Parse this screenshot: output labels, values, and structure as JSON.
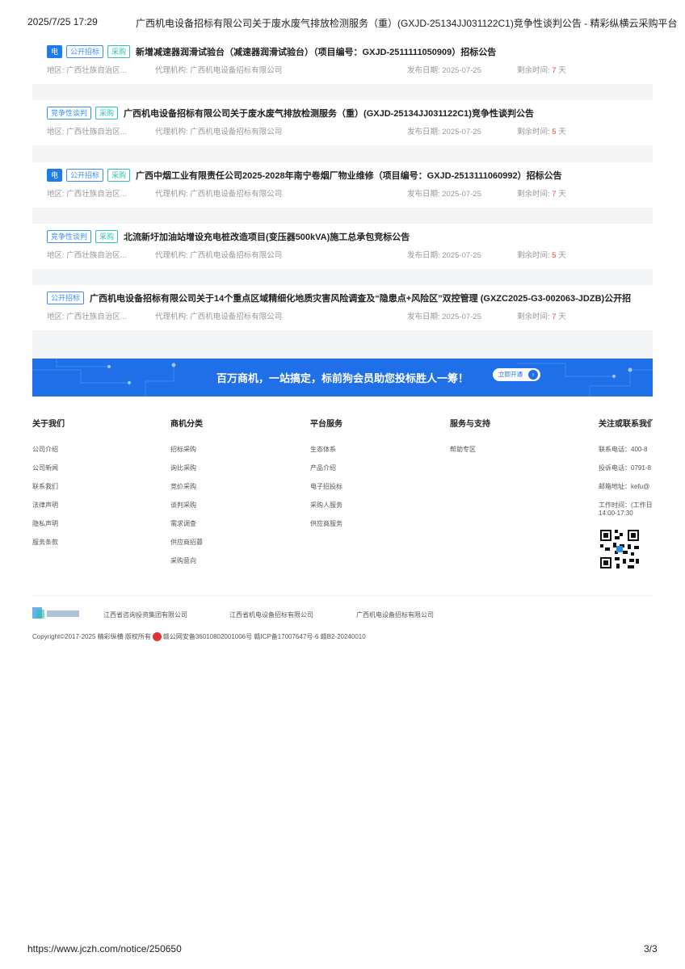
{
  "print_header": {
    "datetime": "2025/7/25 17:29",
    "title": "广西机电设备招标有限公司关于废水废气排放检测服务（重）(GXJD-25134JJ031122C1)竞争性谈判公告 - 精彩纵横云采购平台"
  },
  "notices": [
    {
      "tags": [
        {
          "label": "电",
          "style": "solid"
        },
        {
          "label": "公开招标",
          "style": "blue"
        },
        {
          "label": "采购",
          "style": "green"
        }
      ],
      "title": "新增减速器润滑试验台（减速器润滑试验台）（项目编号：GXJD-2511111050909）招标公告",
      "region": "地区: 广西壮族自治区...",
      "agency": "代理机构: 广西机电设备招标有限公司",
      "publish": "发布日期: 2025-07-25",
      "remaining_label": "剩余时间: ",
      "remaining_days": "7",
      "remaining_unit": " 天"
    },
    {
      "tags": [
        {
          "label": "竞争性谈判",
          "style": "blue"
        },
        {
          "label": "采购",
          "style": "green"
        }
      ],
      "title": "广西机电设备招标有限公司关于废水废气排放检测服务（重）(GXJD-25134JJ031122C1)竞争性谈判公告",
      "region": "地区: 广西壮族自治区...",
      "agency": "代理机构: 广西机电设备招标有限公司",
      "publish": "发布日期: 2025-07-25",
      "remaining_label": "剩余时间: ",
      "remaining_days": "5",
      "remaining_unit": " 天"
    },
    {
      "tags": [
        {
          "label": "电",
          "style": "solid"
        },
        {
          "label": "公开招标",
          "style": "blue"
        },
        {
          "label": "采购",
          "style": "green"
        }
      ],
      "title": "广西中烟工业有限责任公司2025-2028年南宁卷烟厂物业维修（项目编号：GXJD-2513111060992）招标公告",
      "region": "地区: 广西壮族自治区...",
      "agency": "代理机构: 广西机电设备招标有限公司",
      "publish": "发布日期: 2025-07-25",
      "remaining_label": "剩余时间: ",
      "remaining_days": "7",
      "remaining_unit": " 天"
    },
    {
      "tags": [
        {
          "label": "竞争性谈判",
          "style": "blue"
        },
        {
          "label": "采购",
          "style": "green"
        }
      ],
      "title": "北流新圩加油站增设充电桩改造项目(变压器500kVA)施工总承包竞标公告",
      "region": "地区: 广西壮族自治区...",
      "agency": "代理机构: 广西机电设备招标有限公司",
      "publish": "发布日期: 2025-07-25",
      "remaining_label": "剩余时间: ",
      "remaining_days": "5",
      "remaining_unit": " 天"
    },
    {
      "tags": [
        {
          "label": "公开招标",
          "style": "blue"
        }
      ],
      "title": "广西机电设备招标有限公司关于14个重点区域精细化地质灾害风险调查及“隐患点+风险区”双控管理 (GXZC2025-G3-002063-JDZB)公开招",
      "region": "地区: 广西壮族自治区...",
      "agency": "代理机构: 广西机电设备招标有限公司",
      "publish": "发布日期: 2025-07-25",
      "remaining_label": "剩余时间: ",
      "remaining_days": "7",
      "remaining_unit": " 天"
    }
  ],
  "banner": {
    "text": "百万商机，一站搞定，标前狗会员助您投标胜人一筹！",
    "button": "立即开通",
    "arrow": "›"
  },
  "footer": {
    "about": {
      "title": "关于我们",
      "links": [
        "公司介绍",
        "公司新闻",
        "联系我们",
        "法律声明",
        "隐私声明",
        "服务条款"
      ]
    },
    "categories": {
      "title": "商机分类",
      "links": [
        "招标采购",
        "询比采购",
        "竞价采购",
        "谈判采购",
        "需求调查",
        "供应商招募",
        "采购意向"
      ]
    },
    "platform": {
      "title": "平台服务",
      "links": [
        "生态体系",
        "产品介绍",
        "电子招投标",
        "采购人服务",
        "供应商服务"
      ]
    },
    "support": {
      "title": "服务与支持",
      "links": [
        "帮助专区"
      ]
    },
    "contact": {
      "title": "关注或联系我们",
      "lines": [
        "联系电话：400-8",
        "投诉电话：0791-8",
        "邮箱地址：kefu@"
      ],
      "hours": [
        "工作时间：(工作日",
        "14:00-17:30"
      ]
    },
    "partners": [
      "江西省咨询投资集团有限公司",
      "江西省机电设备招标有限公司",
      "广西机电设备招标有限公司"
    ],
    "copyright_a": "Copyright©2017-2025 精彩纵横 版权所有",
    "copyright_b": "赣公网安备36010802001006号 赣ICP备17007647号-6 赣B2-20240010"
  },
  "print_footer": {
    "url": "https://www.jczh.com/notice/250650",
    "page": "3/3"
  },
  "colors": {
    "accent": "#1e6fe8",
    "tag_blue": "#3d8ef4",
    "tag_green": "#2ec0b2",
    "remaining_red": "#e54545"
  }
}
